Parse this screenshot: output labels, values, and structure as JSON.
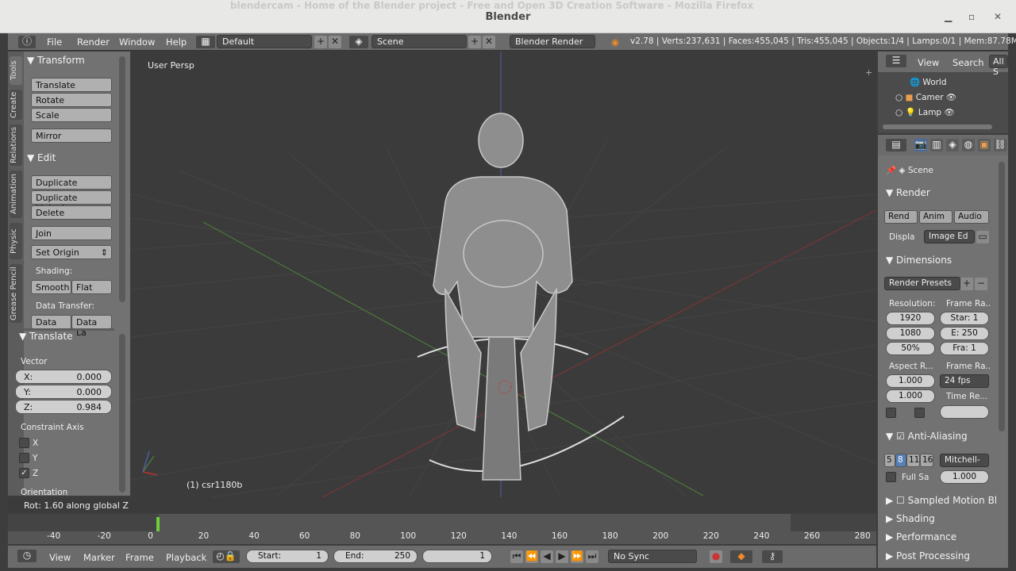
{
  "os": {
    "window_title": "Blender",
    "background_title": "blendercam - Home of the Blender project - Free and Open 3D Creation Software - Mozilla Firefox"
  },
  "header": {
    "menus": [
      "File",
      "Render",
      "Window",
      "Help"
    ],
    "layout": "Default",
    "scene": "Scene",
    "engine": "Blender Render",
    "stats": "v2.78 | Verts:237,631 | Faces:455,045 | Tris:455,045 | Objects:1/4 | Lamps:0/1 | Mem:87.78M"
  },
  "tool_tabs": [
    "Tools",
    "Create",
    "Relations",
    "Animation",
    "Physic",
    "Grease Pencil"
  ],
  "tools": {
    "transform_header": "Transform",
    "transform_buttons": [
      "Translate",
      "Rotate",
      "Scale"
    ],
    "mirror": "Mirror",
    "edit_header": "Edit",
    "edit_buttons": [
      "Duplicate",
      "Duplicate Linked",
      "Delete"
    ],
    "join": "Join",
    "set_origin": "Set Origin",
    "shading_label": "Shading:",
    "smooth": "Smooth",
    "flat": "Flat",
    "data_transfer_label": "Data Transfer:",
    "data": "Data",
    "data_la": "Data La",
    "translate_header": "Translate",
    "vector_label": "Vector",
    "vector": [
      {
        "label": "X:",
        "value": "0.000"
      },
      {
        "label": "Y:",
        "value": "0.000"
      },
      {
        "label": "Z:",
        "value": "0.984"
      }
    ],
    "constraint_label": "Constraint Axis",
    "constraints": [
      {
        "label": "X",
        "checked": false
      },
      {
        "label": "Y",
        "checked": false
      },
      {
        "label": "Z",
        "checked": true
      }
    ],
    "orientation_label": "Orientation"
  },
  "viewport": {
    "view_label": "User Persp",
    "object_label": "(1) csr1180b"
  },
  "info_text": "Rot: 1.60 along global Z",
  "timeline": {
    "ticks": [
      "-40",
      "-20",
      "0",
      "20",
      "40",
      "60",
      "80",
      "100",
      "120",
      "140",
      "160",
      "180",
      "200",
      "220",
      "240",
      "260",
      "280"
    ],
    "current_frame": 1,
    "start_range": 1,
    "end_range": 250
  },
  "timebar": {
    "menus": [
      "View",
      "Marker",
      "Frame",
      "Playback"
    ],
    "start_label": "Start:",
    "start_value": "1",
    "end_label": "End:",
    "end_value": "250",
    "current": "1",
    "sync": "No Sync"
  },
  "outliner": {
    "view": "View",
    "search": "Search",
    "all": "All S",
    "items": [
      "World",
      "Camer",
      "Lamp"
    ]
  },
  "properties": {
    "scene": "Scene",
    "render_header": "Render",
    "render_buttons": [
      "Rend",
      "Anim",
      "Audio"
    ],
    "display_label": "Displa",
    "display_value": "Image Ed",
    "dimensions_header": "Dimensions",
    "render_presets": "Render Presets",
    "resolution_label": "Resolution:",
    "frame_range_label": "Frame Ra...",
    "res_x": "1920",
    "res_y": "1080",
    "res_pct": "50%",
    "frame_start": "Star: 1",
    "frame_end": "E: 250",
    "frame_step": "Fra: 1",
    "aspect_label": "Aspect R...",
    "frame_rate_label": "Frame Ra...",
    "aspect_x": "1.000",
    "aspect_y": "1.000",
    "fps": "24 fps",
    "time_remap_label": "Time Re...",
    "aa_header": "Anti-Aliasing",
    "aa_samples": [
      "5",
      "8",
      "11",
      "16"
    ],
    "aa_filter": "Mitchell-",
    "full_sample": "Full Sa",
    "filter_size": "1.000",
    "sampled_motion": "Sampled Motion Bl",
    "shading": "Shading",
    "performance": "Performance",
    "post_processing": "Post Processing"
  }
}
